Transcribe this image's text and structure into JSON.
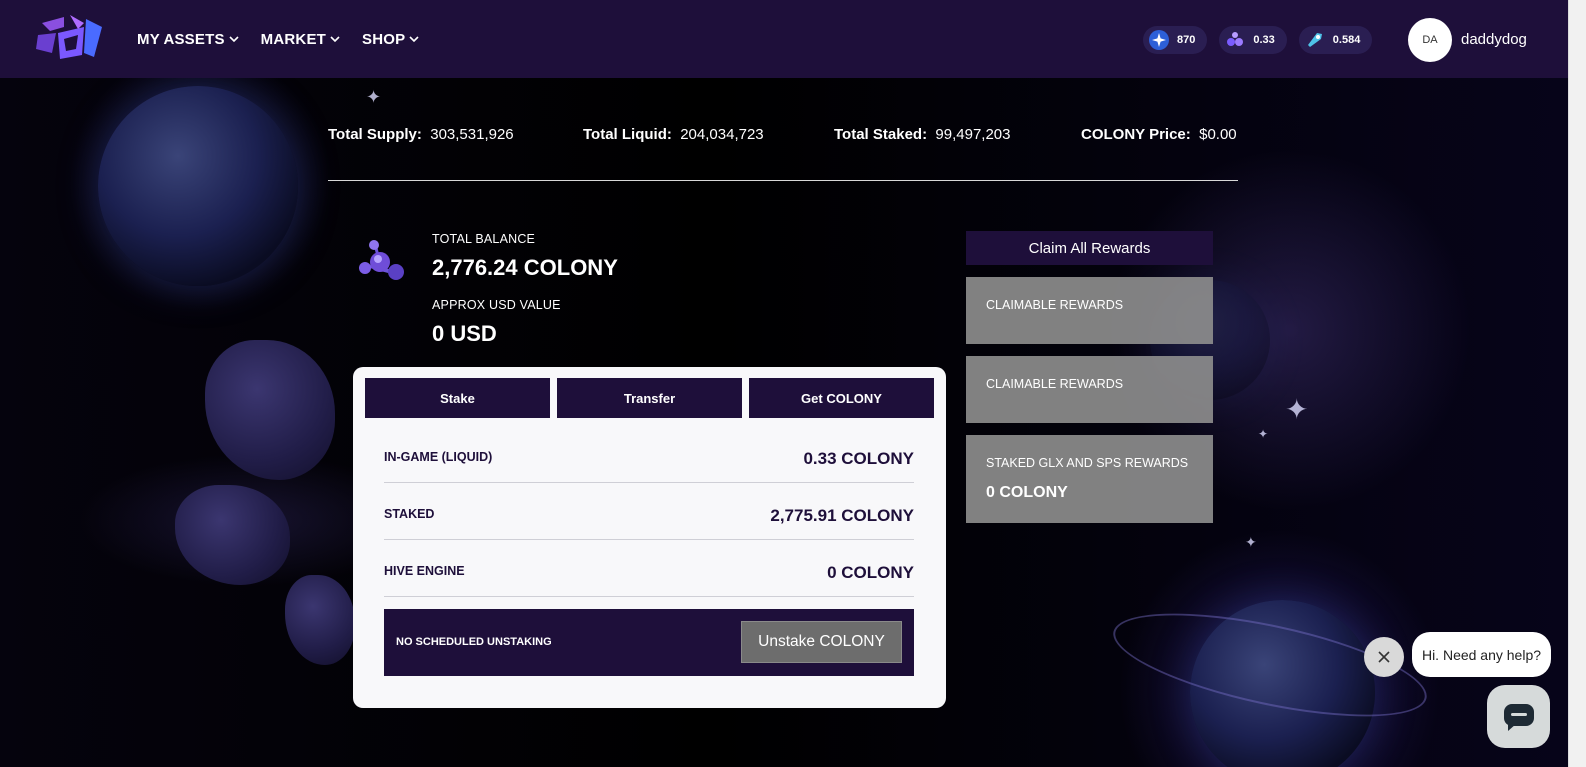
{
  "navbar": {
    "menu": [
      {
        "label": "MY ASSETS"
      },
      {
        "label": "MARKET"
      },
      {
        "label": "SHOP"
      }
    ],
    "currencies": [
      {
        "icon": "credits-icon",
        "value": "870"
      },
      {
        "icon": "colony-molecule-icon",
        "value": "0.33"
      },
      {
        "icon": "rocket-ticket-icon",
        "value": "0.584"
      }
    ],
    "user": {
      "avatar": "DA",
      "name": "daddydog"
    }
  },
  "stats": {
    "supply_label": "Total Supply:",
    "supply_value": "303,531,926",
    "liquid_label": "Total Liquid:",
    "liquid_value": "204,034,723",
    "staked_label": "Total Staked:",
    "staked_value": "99,497,203",
    "price_label": "COLONY Price:",
    "price_value": "$0.00"
  },
  "balance": {
    "total_label": "TOTAL BALANCE",
    "total_value": "2,776.24 COLONY",
    "usd_label": "APPROX USD VALUE",
    "usd_value": "0 USD"
  },
  "panel": {
    "tabs": [
      "Stake",
      "Transfer",
      "Get COLONY"
    ],
    "rows": [
      {
        "label": "IN-GAME (LIQUID)",
        "value": "0.33 COLONY"
      },
      {
        "label": "STAKED",
        "value": "2,775.91 COLONY"
      },
      {
        "label": "HIVE ENGINE",
        "value": "0 COLONY"
      }
    ],
    "unstake_text": "NO SCHEDULED UNSTAKING",
    "unstake_button": "Unstake COLONY"
  },
  "rewards": {
    "claim_all": "Claim All Rewards",
    "cards": [
      {
        "label": "CLAIMABLE REWARDS",
        "value": ""
      },
      {
        "label": "CLAIMABLE REWARDS",
        "value": ""
      },
      {
        "label": "STAKED GLX AND SPS REWARDS",
        "value": "0 COLONY"
      }
    ]
  },
  "chat": {
    "bubble": "Hi. Need any help?"
  },
  "colors": {
    "nav_bg": "#1e0f3a",
    "panel_bg": "#f8f8fa",
    "card_bg": "#8c8c8c"
  }
}
